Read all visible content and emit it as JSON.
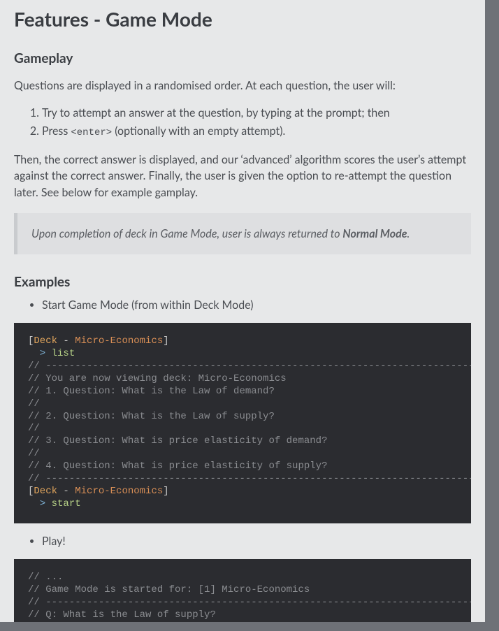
{
  "heading": "Features - Game Mode",
  "gameplay_heading": "Gameplay",
  "gameplay_intro": "Questions are displayed in a randomised order. At each question, the user will:",
  "steps": {
    "one": "Try to attempt an answer at the question, by typing at the prompt; then",
    "two_prefix": "Press ",
    "two_code": "<enter>",
    "two_suffix": " (optionally with an empty attempt)."
  },
  "after_steps": "Then, the correct answer is displayed, and our ‘advanced’ algorithm scores the user’s attempt against the correct answer. Finally, the user is given the option to re-attempt the question later. See below for example gamplay.",
  "callout_prefix": "Upon completion of deck in Game Mode, user is always returned to ",
  "callout_bold": "Normal Mode",
  "callout_suffix": ".",
  "examples_heading": "Examples",
  "example_bullet1": "Start Game Mode (from within Deck Mode)",
  "code1": {
    "l1_open": "[",
    "l1_deck": "Deck",
    "l1_dash": " - ",
    "l1_me": "Micro-Economics",
    "l1_close": "]",
    "l2_prompt": "  > ",
    "l2_cmd": "list",
    "l3": "// --------------------------------------------------------------------------------",
    "l4": "// You are now viewing deck: Micro-Economics",
    "l5": "// 1. Question: What is the Law of demand?",
    "l6": "//",
    "l7": "// 2. Question: What is the Law of supply?",
    "l8": "//",
    "l9": "// 3. Question: What is price elasticity of demand?",
    "l10": "//",
    "l11": "// 4. Question: What is price elasticity of supply?",
    "l12": "// --------------------------------------------------------------------------------",
    "l13_prompt": "  > ",
    "l13_cmd": "start"
  },
  "example_bullet2": "Play!",
  "code2": {
    "l1": "// ...",
    "l2": "// Game Mode is started for: [1] Micro-Economics",
    "l3": "// --------------------------------------------------------------------------------",
    "l4": "// Q: What is the Law of supply?"
  }
}
